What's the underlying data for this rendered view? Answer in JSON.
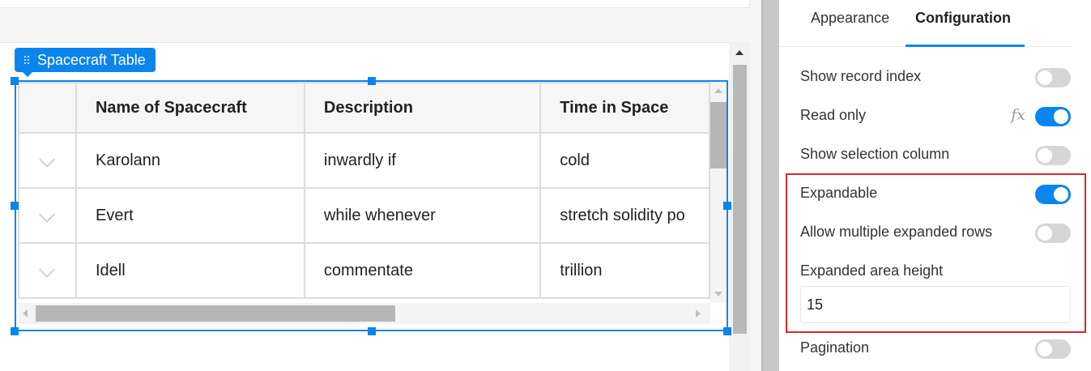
{
  "widget": {
    "name": "Spacecraft Table"
  },
  "table": {
    "columns": [
      "Name of Spacecraft",
      "Description",
      "Time in Space"
    ],
    "rows": [
      {
        "name": "Karolann",
        "description": "inwardly if",
        "time": "cold"
      },
      {
        "name": "Evert",
        "description": "while whenever",
        "time": "stretch solidity po"
      },
      {
        "name": "Idell",
        "description": "commentate",
        "time": "trillion"
      }
    ]
  },
  "panel": {
    "tabs": [
      "Appearance",
      "Configuration"
    ],
    "active_tab": "Configuration",
    "settings": [
      {
        "label": "Show record index",
        "on": false
      },
      {
        "label": "Read only",
        "on": true,
        "formula_icon": "fx"
      },
      {
        "label": "Show selection column",
        "on": false
      },
      {
        "label": "Expandable",
        "on": true
      },
      {
        "label": "Allow multiple expanded rows",
        "on": false
      },
      {
        "label": "Expanded area height"
      },
      {
        "label": "Pagination",
        "on": false
      }
    ],
    "expanded_area_height_value": "15"
  },
  "colors": {
    "accent": "#0a85ee",
    "highlight": "#d42a2a"
  }
}
